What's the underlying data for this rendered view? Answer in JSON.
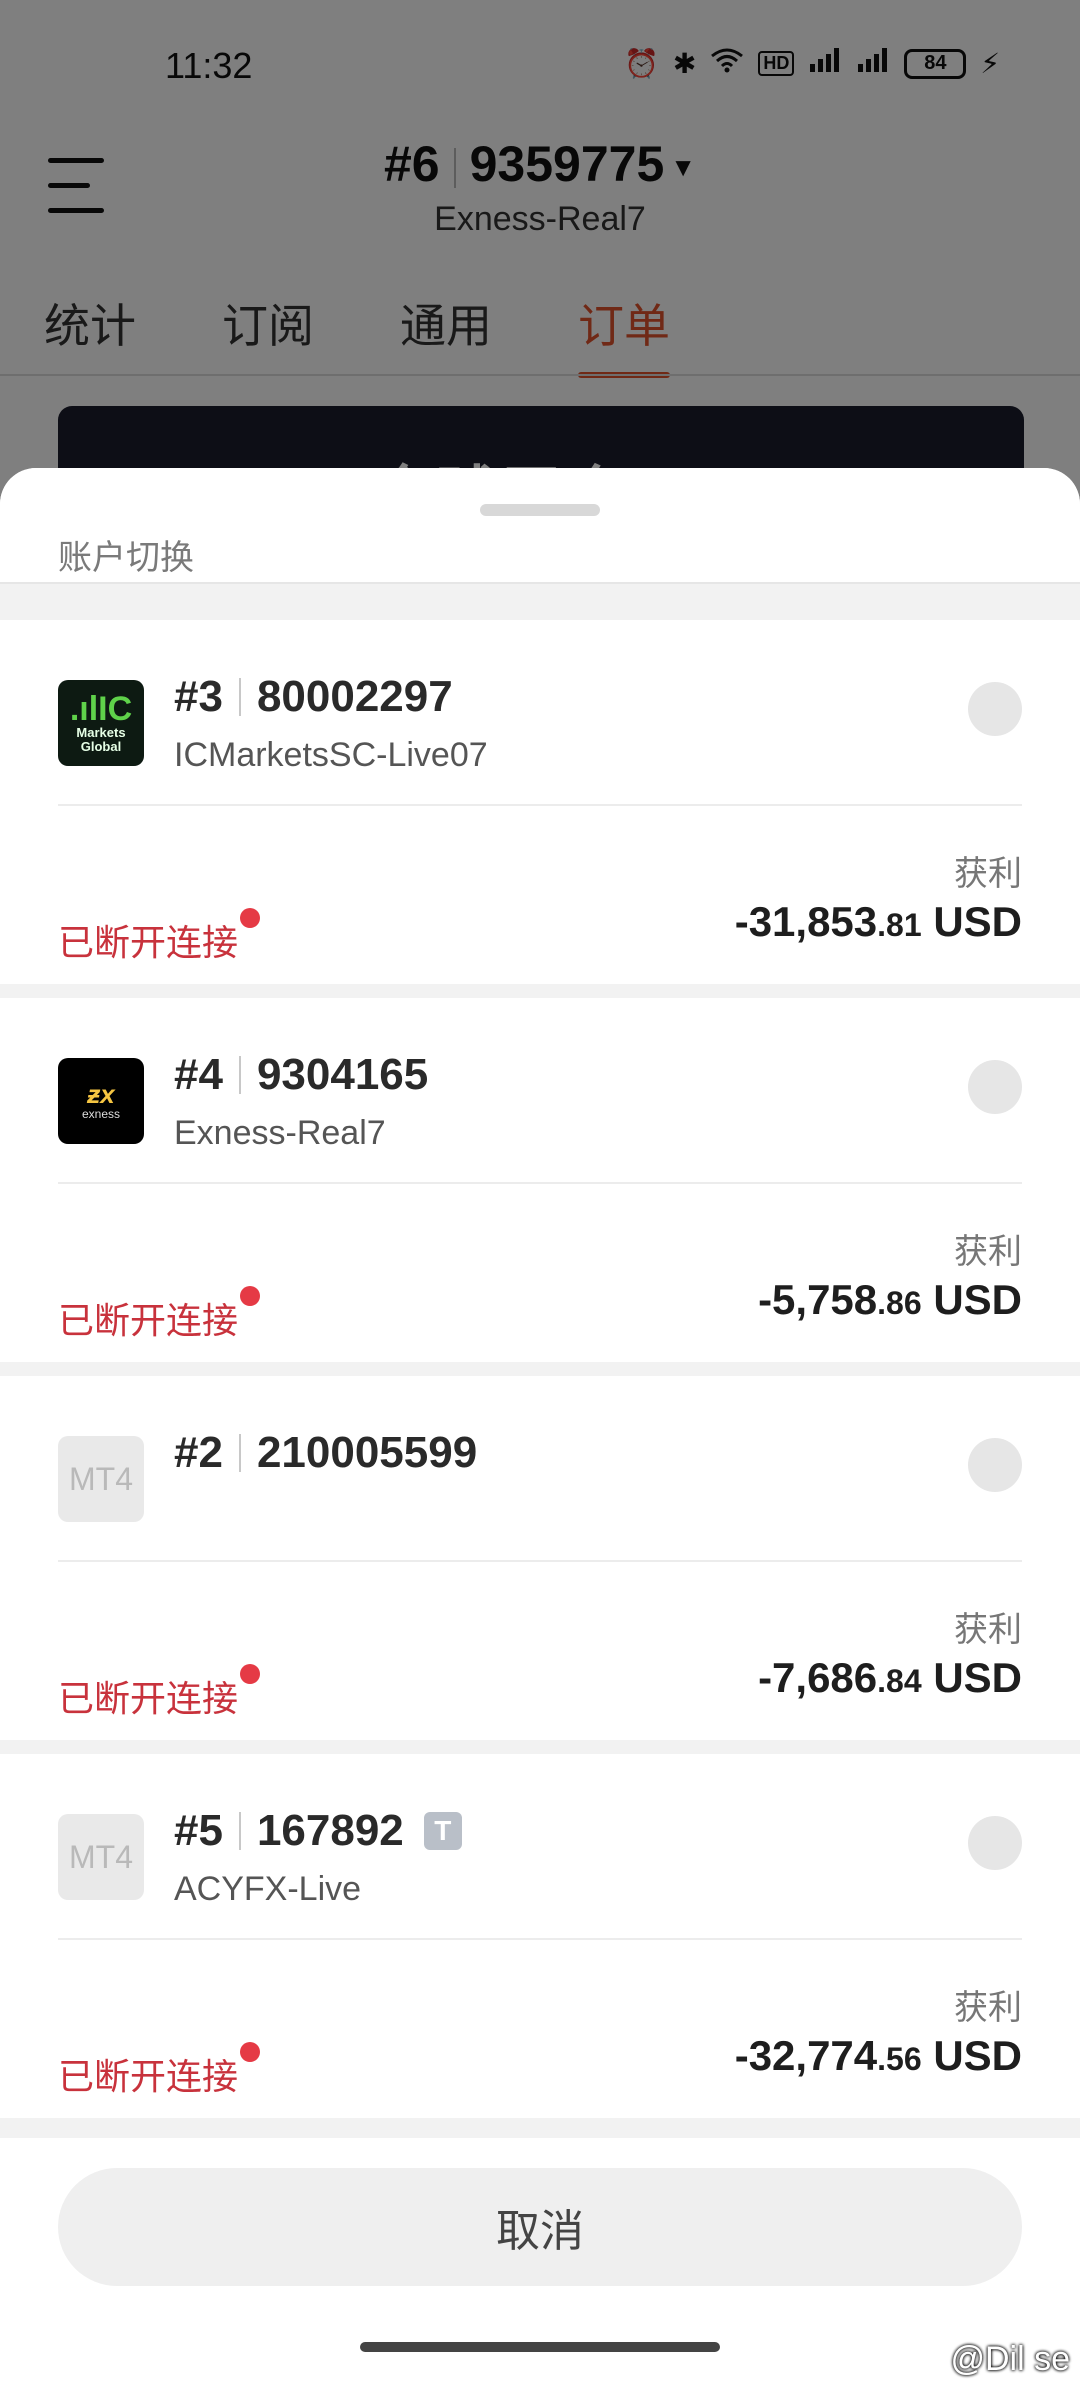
{
  "status_bar": {
    "time": "11:32",
    "battery": "84",
    "icons": [
      "alarm-icon",
      "bluetooth-icon",
      "wifi-icon",
      "hd-icon",
      "5g-signal-icon",
      "4g-signal-icon",
      "battery-icon",
      "charging-icon"
    ]
  },
  "header": {
    "account_index": "#6",
    "account_number": "9359775",
    "server": "Exness-Real7",
    "tabs": [
      {
        "label": "统计"
      },
      {
        "label": "订阅"
      },
      {
        "label": "通用"
      },
      {
        "label": "订单"
      }
    ],
    "active_tab": "订单"
  },
  "banner": {
    "text": "FPO全球平仓"
  },
  "sheet": {
    "title": "账户切换",
    "accounts": [
      {
        "index": "#3",
        "number": "80002297",
        "server": "ICMarketsSC-Live07",
        "logo": "IC Markets Global",
        "status": "已断开连接",
        "profit_label": "获利",
        "profit_int": "-31,853",
        "profit_dec": ".81",
        "currency": "USD"
      },
      {
        "index": "#4",
        "number": "9304165",
        "server": "Exness-Real7",
        "logo": "exness",
        "status": "已断开连接",
        "profit_label": "获利",
        "profit_int": "-5,758",
        "profit_dec": ".86",
        "currency": "USD"
      },
      {
        "index": "#2",
        "number": "210005599",
        "server": "",
        "logo": "MT4",
        "status": "已断开连接",
        "profit_label": "获利",
        "profit_int": "-7,686",
        "profit_dec": ".84",
        "currency": "USD"
      },
      {
        "index": "#5",
        "number": "167892",
        "badge": "T",
        "server": "ACYFX-Live",
        "logo": "MT4",
        "status": "已断开连接",
        "profit_label": "获利",
        "profit_int": "-32,774",
        "profit_dec": ".56",
        "currency": "USD"
      }
    ],
    "cancel_label": "取消"
  },
  "watermark": "@Dil se",
  "colors": {
    "accent": "#e0522c",
    "disconnected": "#c8323c",
    "status_dot": "#e53a45"
  }
}
